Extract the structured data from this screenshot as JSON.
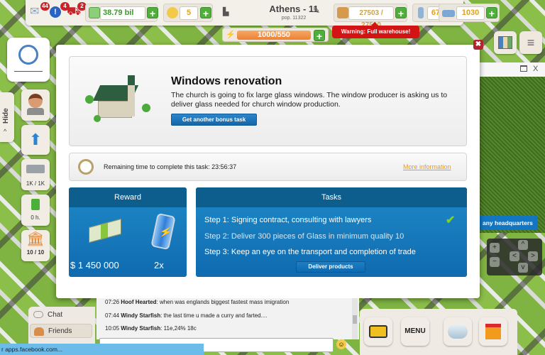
{
  "topbar": {
    "notifications": [
      {
        "name": "messages",
        "icon": "envelope-icon",
        "count": "44"
      },
      {
        "name": "alerts",
        "icon": "exclamation-icon",
        "count": "4"
      },
      {
        "name": "deliveries",
        "icon": "truck-icon",
        "count": "2"
      }
    ],
    "money": {
      "value": "38.79 bil",
      "icon": "cash-icon"
    },
    "gold": {
      "value": "5",
      "icon": "coin-icon"
    },
    "city": {
      "name": "Athens - 11",
      "population": "pop. 11322"
    },
    "warehouse": {
      "value": "27503 / 27500",
      "icon": "warehouse-truck-icon"
    },
    "employees": {
      "value": "675",
      "icon": "building-icon"
    },
    "transport": {
      "value": "1030",
      "icon": "bus-icon"
    },
    "energy": {
      "value": "1000/550",
      "icon": "lightning-icon"
    },
    "warning": "Warning: Full warehouse!"
  },
  "sidebar": {
    "hide_label": "Hide",
    "buttons": [
      {
        "name": "advisor",
        "icon": "advisor-icon",
        "label": ""
      },
      {
        "name": "upgrade",
        "icon": "arrow-up-icon",
        "label": ""
      },
      {
        "name": "trucks",
        "icon": "truck-icon",
        "label": "1K / 1K"
      },
      {
        "name": "fuel",
        "icon": "fuel-icon",
        "label": "0 h."
      },
      {
        "name": "bank",
        "icon": "bank-icon",
        "label": "10 / 10"
      }
    ]
  },
  "modal": {
    "title": "Windows renovation",
    "description": "The church is going to fix large glass windows. The window producer is asking us to deliver glass needed for church window production.",
    "bonus_button": "Get another bonus task",
    "timer_label": "Remaining time to complete this task: 23:56:37",
    "more_info": "More information",
    "reward": {
      "header": "Reward",
      "money": "$ 1 450 000",
      "multiplier": "2x"
    },
    "tasks": {
      "header": "Tasks",
      "steps": [
        {
          "text": "Step 1: Signing contract, consulting with lawyers",
          "done": true
        },
        {
          "text": "Step 2: Deliver 300 pieces of Glass in minimum quality 10",
          "done": false
        },
        {
          "text": "Step 3: Keep an eye on the transport and completion of trade",
          "done": false
        }
      ],
      "deliver_button": "Deliver products"
    }
  },
  "right_panel": {
    "close_label": "X",
    "hq_button": "any headquarters"
  },
  "chat": {
    "tabs": [
      {
        "label": "Chat"
      },
      {
        "label": "Friends"
      }
    ],
    "messages": [
      {
        "time": "07:26",
        "user": "Hoof Hearted",
        "text": ": when was englands biggest fastest mass imigration"
      },
      {
        "time": "07:44",
        "user": "Windy Starfish",
        "text": ": the last time u made a curry and farted...."
      },
      {
        "time": "10:05",
        "user": "Windy Starfish",
        "text": ": 11e,24% 18c"
      }
    ]
  },
  "bottom": {
    "menu_label": "MENU"
  },
  "status_bar": "r apps.facebook.com...",
  "colors": {
    "accent_blue": "#1f8ac7",
    "warning_red": "#d31414",
    "money_green": "#3a9a2a",
    "gold": "#e0a11b"
  }
}
